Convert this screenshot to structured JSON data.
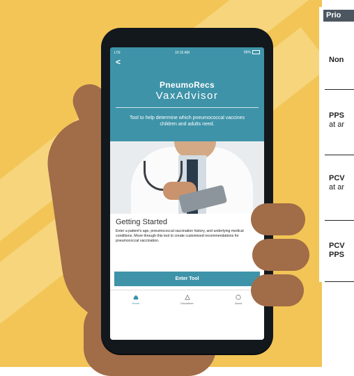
{
  "status_bar": {
    "carrier": "LTE",
    "time": "10:15 AM",
    "battery": "86%"
  },
  "app": {
    "back_label": "<",
    "brand_line1": "PneumoRecs",
    "brand_line2": "VaxAdvisor",
    "tagline": "Tool to help determine which pneumococcal vaccines children and adults need."
  },
  "getting_started": {
    "title": "Getting Started",
    "body": "Enter a patient's age, pneumococcal vaccination history, and underlying medical conditions. Move through this tool to create customized recommendations for pneumococcal vaccination.",
    "button_label": "Enter Tool"
  },
  "tabbar": {
    "items": [
      {
        "label": "Home",
        "icon": "home-icon",
        "active": true
      },
      {
        "label": "Disclaimer",
        "icon": "warning-icon",
        "active": false
      },
      {
        "label": "About",
        "icon": "info-icon",
        "active": false
      }
    ]
  },
  "side_panel": {
    "header": "Prio",
    "rows": [
      {
        "line1": "Non",
        "line2": ""
      },
      {
        "line1": "PPS",
        "line2": "at ar"
      },
      {
        "line1": "PCV",
        "line2": "at ar"
      },
      {
        "line1": "PCV",
        "line2": "PPS"
      }
    ]
  },
  "colors": {
    "teal": "#3e93a8",
    "yellow": "#f2c556",
    "skin": "#a16c48",
    "phone": "#13181d",
    "header_bg": "#4c5661"
  }
}
